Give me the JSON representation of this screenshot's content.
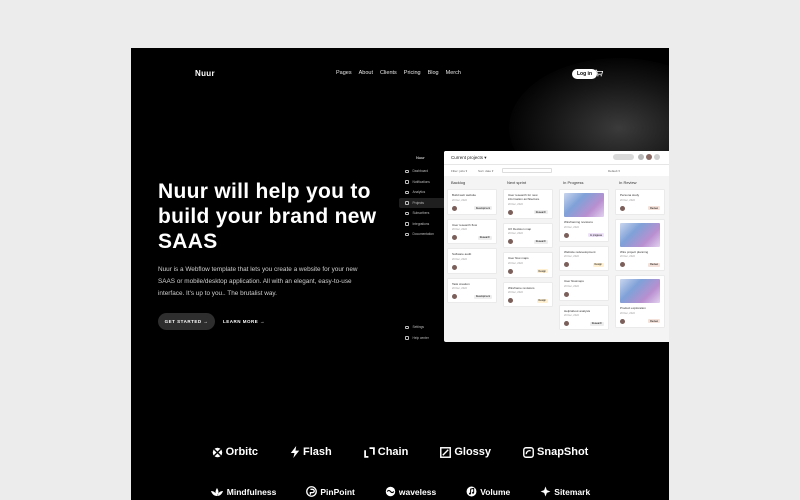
{
  "header": {
    "logo": "Nuur",
    "nav": [
      "Pages",
      "About",
      "Clients",
      "Pricing",
      "Blog",
      "Merch"
    ],
    "login_label": "Log in"
  },
  "hero": {
    "headline_strong": "Nuur",
    "headline_rest": " will help you to build your brand new SAAS",
    "description": "Nuur is a Webflow template that lets you create a website for your new SAAS or mobile/desktop application. All with an elegant, easy-to-use interface. It's up to you.. The brutalist way.",
    "start_label": "GET STARTED →",
    "learn_label": "LEARN MORE →"
  },
  "mockup": {
    "sidebar_title": "Nuur",
    "sidebar": [
      "Dashboard",
      "Notifications",
      "Analytics",
      "Projects",
      "Subscribers",
      "Integrations",
      "Documentation"
    ],
    "sidebar_bottom": [
      "Settings",
      "Help center"
    ],
    "app_title": "Current projects ▾",
    "filters": [
      "Filter: jobs ▾",
      "Sort: date ▾"
    ],
    "filter_right": "Default ▾",
    "columns": [
      {
        "title": "Backlog",
        "cards": [
          {
            "title": "Build web website",
            "date": "20 Dec, 2022",
            "tag": "Development"
          },
          {
            "title": "User research flow",
            "date": "20 Dec, 2022",
            "tag": "Research"
          },
          {
            "title": "Software audit",
            "date": "20 Dec, 2022",
            "tag": ""
          },
          {
            "title": "Task creation",
            "date": "20 Dec, 2022",
            "tag": "Development"
          }
        ]
      },
      {
        "title": "Next sprint",
        "cards": [
          {
            "title": "User research for new information architecture",
            "date": "20 Dec, 2022",
            "tag": "Research"
          },
          {
            "title": "UX Decision map",
            "date": "20 Dec, 2022",
            "tag": "Research"
          },
          {
            "title": "User flow maps",
            "date": "20 Dec, 2022",
            "tag": "Design"
          },
          {
            "title": "Wireframe revisions",
            "date": "20 Dec, 2022",
            "tag": "Design"
          }
        ]
      },
      {
        "title": "In Progress",
        "cards": [
          {
            "title": "Wireframing revisions",
            "date": "20 Dec, 2022",
            "tag": "In progress",
            "thumb": true
          },
          {
            "title": "Website redevelopment",
            "date": "20 Dec, 2022",
            "tag": "Design"
          },
          {
            "title": "User flowmaps",
            "date": "20 Dec, 2022",
            "tag": ""
          },
          {
            "title": "Help/about analysis",
            "date": "20 Dec, 2022",
            "tag": "Research"
          }
        ]
      },
      {
        "title": "In Review",
        "cards": [
          {
            "title": "Persona study",
            "date": "20 Dec, 2022",
            "tag": "Review"
          },
          {
            "title": "Wire project planning",
            "date": "20 Dec, 2022",
            "tag": "Review",
            "thumb": true
          },
          {
            "title": "Product exploration",
            "date": "20 Dec, 2022",
            "tag": "Review",
            "thumb": true
          }
        ]
      }
    ]
  },
  "logos_row1": [
    {
      "name": "Orbitc",
      "icon": "orbit-icon"
    },
    {
      "name": "Flash",
      "icon": "lightning-icon"
    },
    {
      "name": "Chain",
      "icon": "chain-icon"
    },
    {
      "name": "Glossy",
      "icon": "glossy-icon"
    },
    {
      "name": "SnapShot",
      "icon": "snapshot-icon"
    }
  ],
  "logos_row2": [
    {
      "name": "Mindfulness",
      "icon": "lotus-icon"
    },
    {
      "name": "PinPoint",
      "icon": "pin-icon"
    },
    {
      "name": "waveless",
      "icon": "wave-icon"
    },
    {
      "name": "Volume",
      "icon": "note-icon"
    },
    {
      "name": "Sitemark",
      "icon": "sitemark-icon"
    }
  ],
  "colors": {
    "background": "#000000",
    "accent": "#ffffff",
    "button_dark": "#2e2e2e"
  }
}
